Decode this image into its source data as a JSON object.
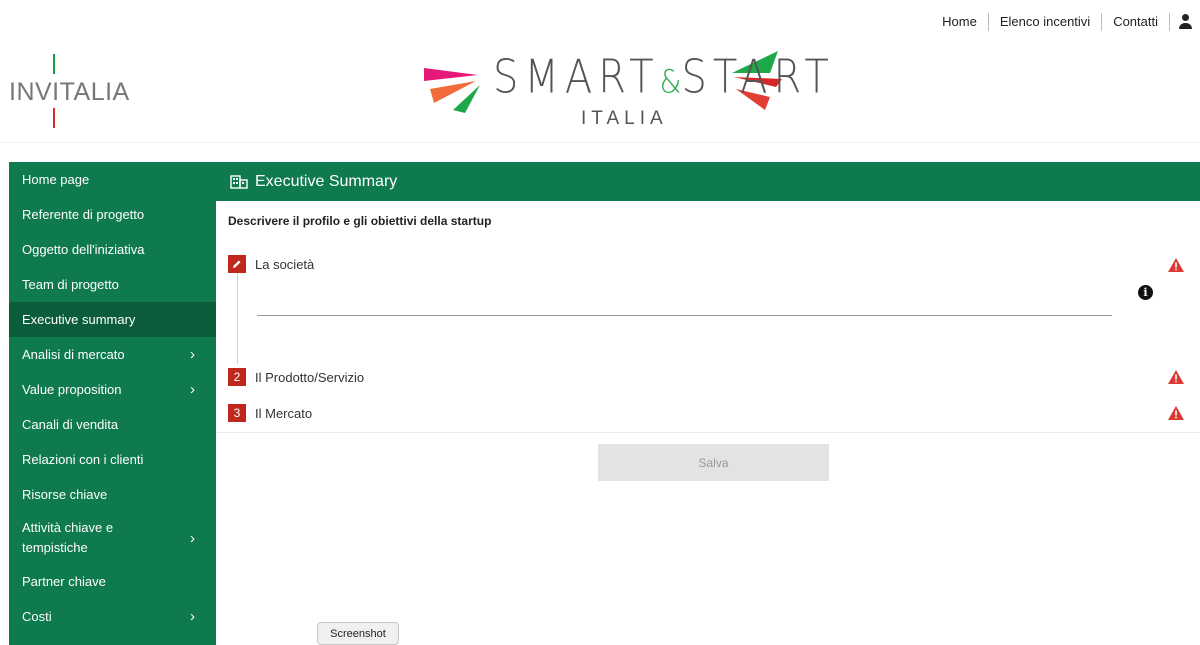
{
  "topnav": {
    "items": [
      "Home",
      "Elenco incentivi",
      "Contatti"
    ]
  },
  "logos": {
    "invitalia": "INVITALIA",
    "brand_title_1": "SMART",
    "brand_amp": "&",
    "brand_title_2": "START",
    "brand_sub": "ITALIA"
  },
  "sidebar": {
    "items": [
      {
        "label": "Home page",
        "has_children": false
      },
      {
        "label": "Referente di progetto",
        "has_children": false
      },
      {
        "label": "Oggetto dell'iniziativa",
        "has_children": false
      },
      {
        "label": "Team di progetto",
        "has_children": false
      },
      {
        "label": "Executive summary",
        "has_children": false,
        "active": true
      },
      {
        "label": "Analisi di mercato",
        "has_children": true
      },
      {
        "label": "Value proposition",
        "has_children": true
      },
      {
        "label": "Canali di vendita",
        "has_children": false
      },
      {
        "label": "Relazioni con i clienti",
        "has_children": false
      },
      {
        "label": "Risorse chiave",
        "has_children": false
      },
      {
        "label": "Attività chiave e tempistiche",
        "has_children": true
      },
      {
        "label": "Partner chiave",
        "has_children": false
      },
      {
        "label": "Costi",
        "has_children": true
      }
    ]
  },
  "main": {
    "title": "Executive Summary",
    "subtitle": "Descrivere il profilo e gli obiettivi della startup",
    "steps": [
      {
        "num": "",
        "label": "La società",
        "icon": "pencil-icon"
      },
      {
        "num": "2",
        "label": "Il Prodotto/Servizio"
      },
      {
        "num": "3",
        "label": "Il Mercato"
      }
    ],
    "save_label": "Salva"
  },
  "screenshot_label": "Screenshot",
  "colors": {
    "primary_green": "#0e7a4d",
    "active_green": "#0a5c3a",
    "step_red": "#c0281d",
    "warning_red": "#d93a32"
  }
}
